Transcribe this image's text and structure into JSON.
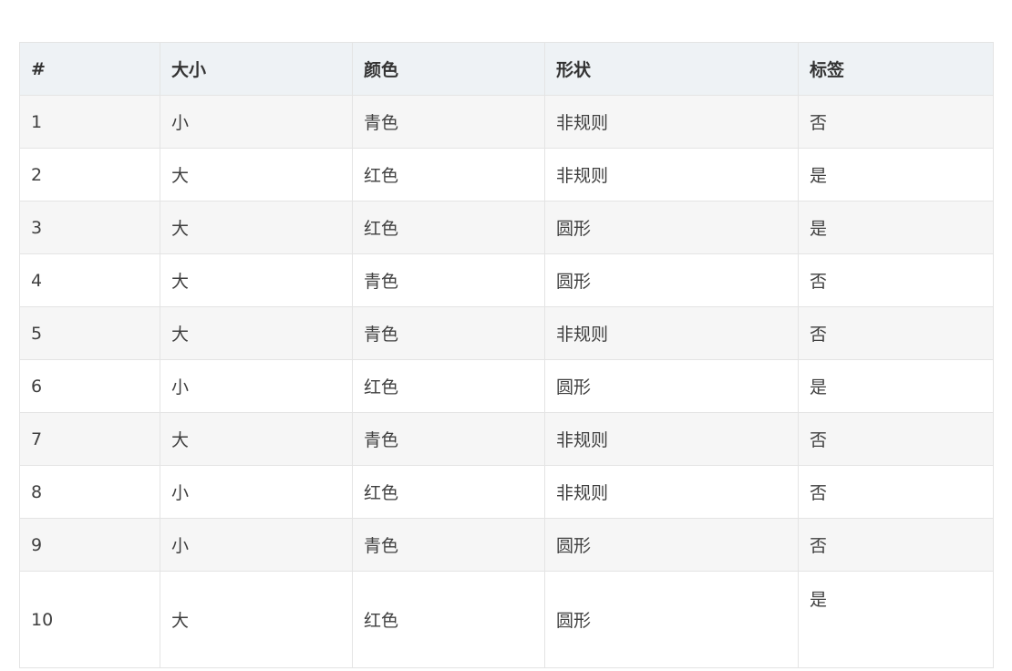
{
  "table": {
    "headers": [
      "#",
      "大小",
      "颜色",
      "形状",
      "标签"
    ],
    "rows": [
      [
        "1",
        "小",
        "青色",
        "非规则",
        "否"
      ],
      [
        "2",
        "大",
        "红色",
        "非规则",
        "是"
      ],
      [
        "3",
        "大",
        "红色",
        "圆形",
        "是"
      ],
      [
        "4",
        "大",
        "青色",
        "圆形",
        "否"
      ],
      [
        "5",
        "大",
        "青色",
        "非规则",
        "否"
      ],
      [
        "6",
        "小",
        "红色",
        "圆形",
        "是"
      ],
      [
        "7",
        "大",
        "青色",
        "非规则",
        "否"
      ],
      [
        "8",
        "小",
        "红色",
        "非规则",
        "否"
      ],
      [
        "9",
        "小",
        "青色",
        "圆形",
        "否"
      ],
      [
        "10",
        "大",
        "红色",
        "圆形",
        "是"
      ]
    ]
  }
}
